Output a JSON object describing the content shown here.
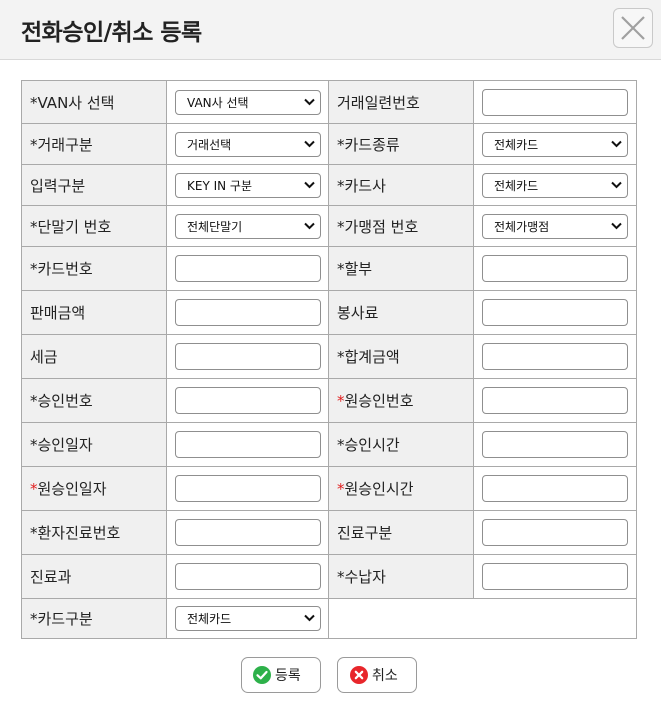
{
  "header": {
    "title": "전화승인/취소 등록"
  },
  "form": {
    "rows": [
      {
        "left": {
          "mark": "*",
          "label": "VAN사 선택",
          "type": "select",
          "value": "VAN사 선택"
        },
        "right": {
          "mark": "",
          "label": "거래일련번호",
          "type": "input",
          "value": ""
        }
      },
      {
        "left": {
          "mark": "*",
          "label": "거래구분",
          "type": "select",
          "value": "거래선택"
        },
        "right": {
          "mark": "*",
          "label": "카드종류",
          "type": "select",
          "value": "전체카드"
        }
      },
      {
        "left": {
          "mark": "",
          "label": "입력구분",
          "type": "select",
          "value": "KEY IN 구분"
        },
        "right": {
          "mark": "*",
          "label": "카드사",
          "type": "select",
          "value": "전체카드"
        }
      },
      {
        "left": {
          "mark": "*",
          "label": "단말기 번호",
          "type": "select",
          "value": "전체단말기"
        },
        "right": {
          "mark": "*",
          "label": "가맹점 번호",
          "type": "select",
          "value": "전체가맹점"
        }
      },
      {
        "left": {
          "mark": "*",
          "label": "카드번호",
          "type": "input",
          "value": ""
        },
        "right": {
          "mark": "*",
          "label": "할부",
          "type": "input",
          "value": ""
        }
      },
      {
        "left": {
          "mark": "",
          "label": "판매금액",
          "type": "input",
          "value": ""
        },
        "right": {
          "mark": "",
          "label": "봉사료",
          "type": "input",
          "value": ""
        }
      },
      {
        "left": {
          "mark": "",
          "label": "세금",
          "type": "input",
          "value": ""
        },
        "right": {
          "mark": "*",
          "label": "합계금액",
          "type": "input",
          "value": ""
        }
      },
      {
        "left": {
          "mark": "*",
          "label": "승인번호",
          "type": "input",
          "value": ""
        },
        "right": {
          "mark": "*",
          "markRed": true,
          "label": "원승인번호",
          "type": "input",
          "value": ""
        }
      },
      {
        "left": {
          "mark": "*",
          "label": "승인일자",
          "type": "input",
          "value": ""
        },
        "right": {
          "mark": "*",
          "label": "승인시간",
          "type": "input",
          "value": ""
        }
      },
      {
        "left": {
          "mark": "*",
          "markRed": true,
          "label": "원승인일자",
          "type": "input",
          "value": ""
        },
        "right": {
          "mark": "*",
          "markRed": true,
          "label": "원승인시간",
          "type": "input",
          "value": ""
        }
      },
      {
        "left": {
          "mark": "*",
          "label": "환자진료번호",
          "type": "input",
          "value": ""
        },
        "right": {
          "mark": "",
          "label": "진료구분",
          "type": "input",
          "value": ""
        }
      },
      {
        "left": {
          "mark": "",
          "label": "진료과",
          "type": "input",
          "value": ""
        },
        "right": {
          "mark": "*",
          "label": "수납자",
          "type": "input",
          "value": ""
        }
      },
      {
        "left": {
          "mark": "*",
          "label": "카드구분",
          "type": "select",
          "value": "전체카드"
        },
        "right": null
      }
    ]
  },
  "buttons": {
    "register": {
      "label": "등록",
      "icon": "check-circle-icon",
      "color": "#2db14a"
    },
    "cancel": {
      "label": "취소",
      "icon": "x-circle-icon",
      "color": "#e8262b"
    }
  },
  "colors": {
    "required_mark": "#e02020",
    "label_bg": "#f0f0f0",
    "border": "#a9a9a9"
  }
}
